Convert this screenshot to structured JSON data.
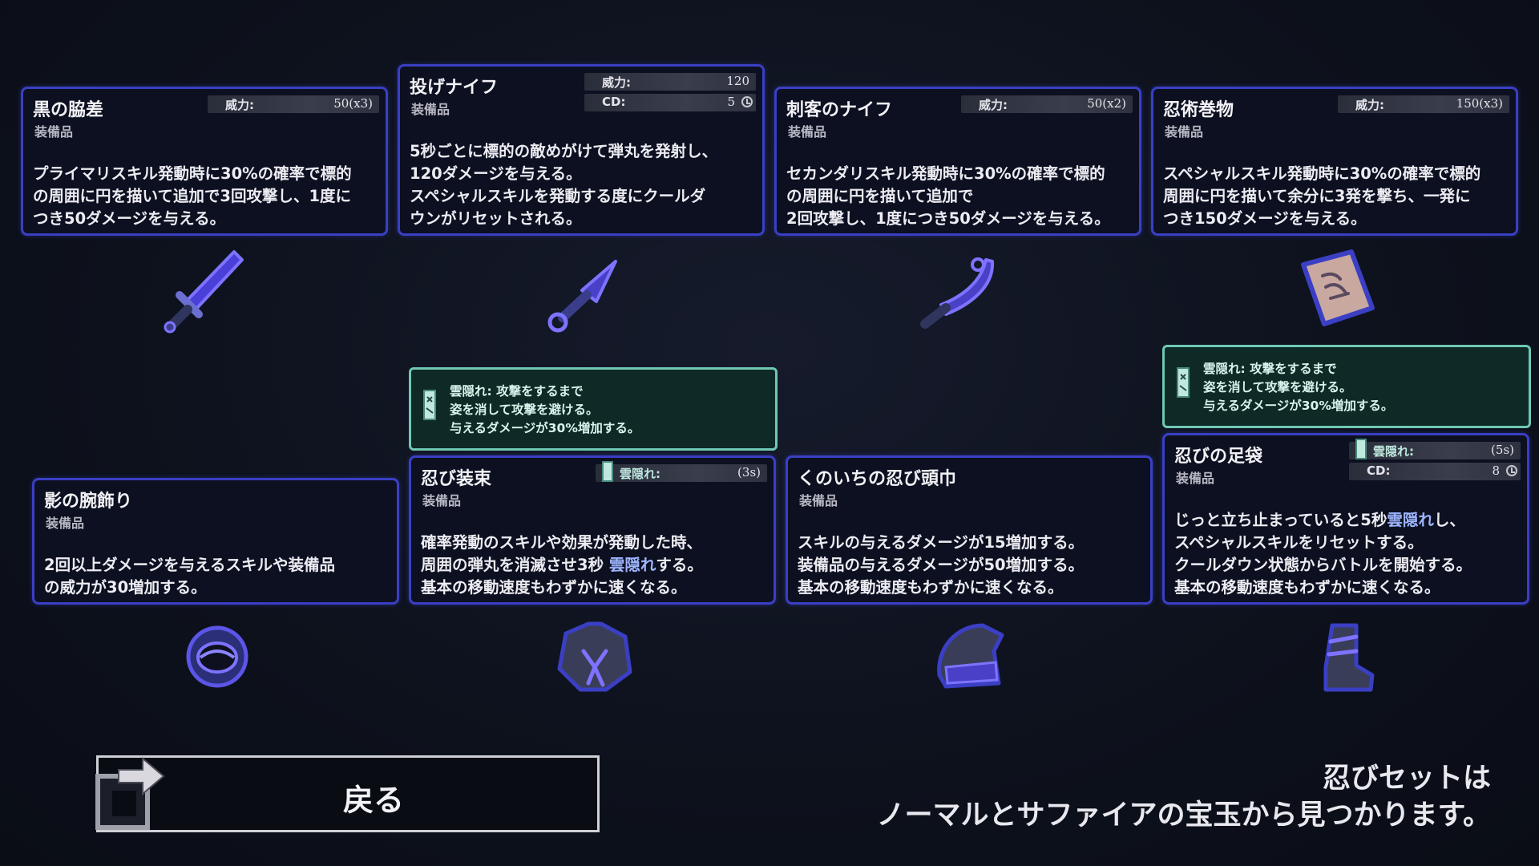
{
  "cards": {
    "kuro": {
      "title": "黒の脇差",
      "subtitle": "装備品",
      "stat1_key": "威力:",
      "stat1_val": "50(x3)",
      "desc": "プライマリスキル発動時に30%の確率で標的\nの周囲に円を描いて追加で3回攻撃し、1度に\nつき50ダメージを与える。"
    },
    "nage": {
      "title": "投げナイフ",
      "subtitle": "装備品",
      "stat1_key": "威力:",
      "stat1_val": "120",
      "stat2_key": "CD:",
      "stat2_val": "5",
      "desc": "5秒ごとに標的の敵めがけて弾丸を発射し、\n120ダメージを与える。\nスペシャルスキルを発動する度にクールダ\nウンがリセットされる。"
    },
    "shikaku": {
      "title": "刺客のナイフ",
      "subtitle": "装備品",
      "stat1_key": "威力:",
      "stat1_val": "50(x2)",
      "desc": "セカンダリスキル発動時に30%の確率で標的\nの周囲に円を描いて追加で\n2回攻撃し、1度につき50ダメージを与える。"
    },
    "ninjutsu": {
      "title": "忍術巻物",
      "subtitle": "装備品",
      "stat1_key": "威力:",
      "stat1_val": "150(x3)",
      "desc": "スペシャルスキル発動時に30%の確率で標的\n周囲に円を描いて余分に3発を撃ち、一発に\nつき150ダメージを与える。"
    },
    "kage": {
      "title": "影の腕飾り",
      "subtitle": "装備品",
      "desc": "2回以上ダメージを与えるスキルや装備品\nの威力が30増加する。"
    },
    "shinobi": {
      "title": "忍び装束",
      "subtitle": "装備品",
      "stat1_key": "雲隠れ:",
      "stat1_val": "(3s)",
      "desc_pre": "確率発動のスキルや効果が発動した時、\n周囲の弾丸を消滅させ3秒 ",
      "desc_hl": "雲隠れ",
      "desc_post": "する。\n基本の移動速度もわずかに速くなる。"
    },
    "kunoichi": {
      "title": "くのいちの忍び頭巾",
      "subtitle": "装備品",
      "desc": "スキルの与えるダメージが15増加する。\n装備品の与えるダメージが50増加する。\n基本の移動速度もわずかに速くなる。"
    },
    "ashibukuro": {
      "title": "忍びの足袋",
      "subtitle": "装備品",
      "stat1_key": "雲隠れ:",
      "stat1_val": "(5s)",
      "stat2_key": "CD:",
      "stat2_val": "8",
      "desc_pre": "じっと立ち止まっていると5秒",
      "desc_hl": "雲隠れ",
      "desc_post": "し、\nスペシャルスキルをリセットする。\nクールダウン状態からバトルを開始する。\n基本の移動速度もわずかに速くなる。"
    }
  },
  "tips": {
    "tip1": "雲隠れ: 攻撃をするまで\n姿を消して攻撃を避ける。\n与えるダメージが30%増加する。",
    "tip2": "雲隠れ: 攻撃をするまで\n姿を消して攻撃を避ける。\n与えるダメージが30%増加する。"
  },
  "icons": [
    "sword-icon",
    "kunai-icon",
    "curved-knife-icon",
    "scroll-icon",
    "bracelet-icon",
    "ninja-garb-icon",
    "hood-icon",
    "tabi-boots-icon"
  ],
  "back_button": {
    "label": "戻る"
  },
  "footer": {
    "line1": "忍びセットは",
    "line2": "ノーマルとサファイアの宝玉から見つかります。"
  },
  "colors": {
    "card_border": "#3a3fc4",
    "tip_border": "#6ec8b4",
    "highlight": "#9fb6ff"
  }
}
